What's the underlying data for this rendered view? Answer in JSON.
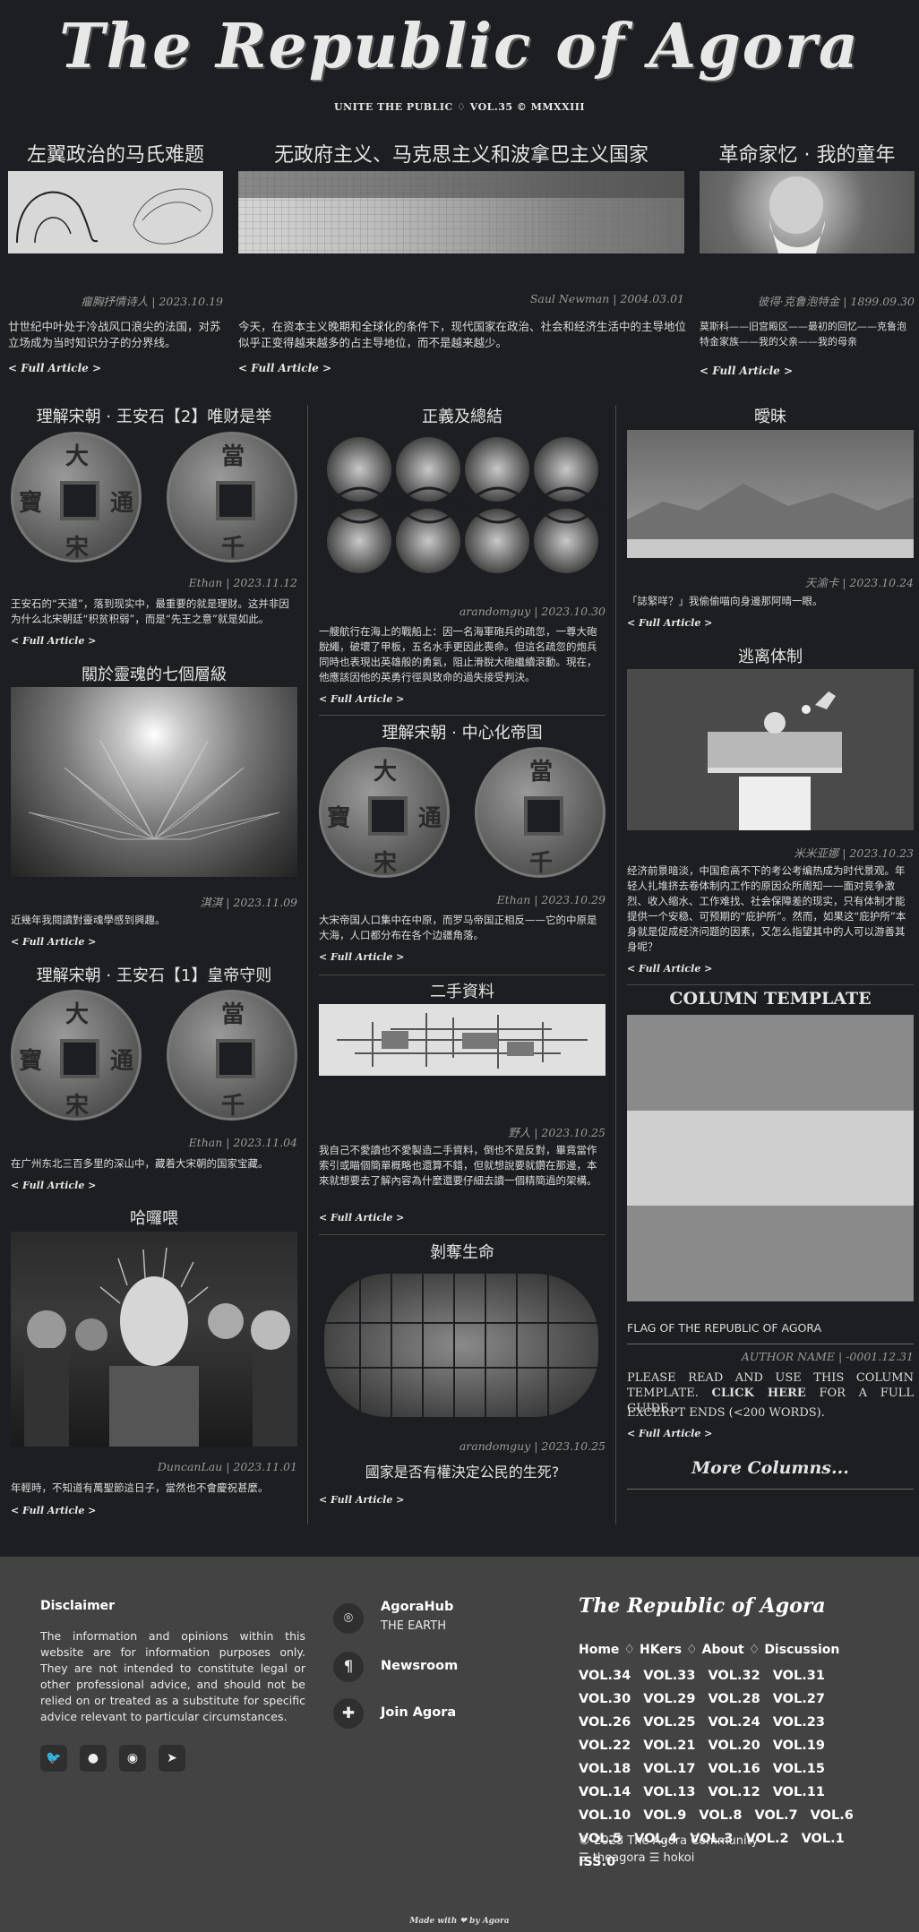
{
  "masthead": {
    "title": "The Republic of Agora",
    "tagline": "UNITE THE PUBLIC ♢ VOL.35 © MMXXIII"
  },
  "top_articles": [
    {
      "title": "左翼政治的马氏难题",
      "meta": "瘤胸抒情诗人 | 2023.10.19",
      "excerpt": "廿世纪中叶处于冷战风口浪尖的法国，对苏立场成为当时知识分子的分界线。",
      "more": "< Full Article >"
    },
    {
      "title": "无政府主义、马克思主义和波拿巴主义国家",
      "meta": "Saul Newman | 2004.03.01",
      "excerpt": "今天，在资本主义晚期和全球化的条件下，现代国家在政治、社会和经济生活中的主导地位似乎正变得越来越多的占主导地位，而不是越来越少。",
      "more": "< Full Article >"
    },
    {
      "title": "革命家忆 · 我的童年",
      "meta": "彼得·克鲁泡特金 | 1899.09.30",
      "excerpt": "莫斯科——旧宫殿区——最初的回忆——克鲁泡特金家族——我的父亲——我的母亲",
      "more": "< Full Article >"
    }
  ],
  "col1": [
    {
      "title": "理解宋朝 · 王安石【2】唯财是举",
      "meta": "Ethan | 2023.11.12",
      "excerpt": "王安石的“天道”，落到现实中，最重要的就是理财。这并非因为什么北宋朝廷“积贫积弱”，而是“先王之意”就是如此。",
      "more": "< Full Article >"
    },
    {
      "title": "關於靈魂的七個層級",
      "meta": "淇淇 | 2023.11.09",
      "excerpt": "近幾年我閱讀對靈魂學感到興趣。",
      "more": "< Full Article >"
    },
    {
      "title": "理解宋朝 · 王安石【1】皇帝守则",
      "meta": "Ethan | 2023.11.04",
      "excerpt": "在广州东北三百多里的深山中，藏着大宋朝的国家宝藏。",
      "more": "< Full Article >"
    },
    {
      "title": "哈囉喂",
      "meta": "DuncanLau | 2023.11.01",
      "excerpt": "年輕時，不知道有萬聖節這日子，當然也不會慶祝甚麼。",
      "more": "< Full Article >"
    }
  ],
  "col2": [
    {
      "title": "正義及總結",
      "meta": "arandomguy | 2023.10.30",
      "excerpt": "一艘航行在海上的戰船上：因一名海軍砲兵的疏忽，一尊大砲脫繩，破壞了甲板，五名水手更因此喪命。但這名疏忽的炮兵同時也表現出英雄般的勇氣，阻止滑脫大砲繼續滾動。現在，他應該因他的英勇行徑與致命的過失接受判決。",
      "more": "< Full Article >"
    },
    {
      "title": "理解宋朝 · 中心化帝国",
      "meta": "Ethan | 2023.10.29",
      "excerpt": "大宋帝国人口集中在中原，而罗马帝国正相反——它的中原是大海，人口都分布在各个边疆角落。",
      "more": "< Full Article >"
    },
    {
      "title": "二手資料",
      "meta": "野人 | 2023.10.25",
      "excerpt": "我自己不愛讀也不愛製造二手資料，倒也不是反對，畢竟當作索引或瞄個簡單概略也還算不錯，但就想說要就鑽在那邊，本來就想要去了解內容為什麼還要仔細去讀一個精簡過的架構。",
      "more": "< Full Article >"
    },
    {
      "title": "剝奪生命",
      "meta": "arandomguy | 2023.10.25",
      "subtitle": "國家是否有權決定公民的生死?",
      "more": "< Full Article >"
    }
  ],
  "col3": [
    {
      "title": "曖昧",
      "meta": "天渝卡 | 2023.10.24",
      "excerpt": "「誌緊咩？」我偷偷喵向身邊那阿晴一眼。",
      "more": "< Full Article >"
    },
    {
      "title": "逃离体制",
      "meta": "米米亚娜 | 2023.10.23",
      "excerpt": "经济前景暗淡，中国愈高不下的考公考编热成为时代景观。年轻人扎堆挤去卷体制内工作的原因众所周知——面对竞争激烈、收入缩水、工作难找、社会保障差的现实，只有体制才能提供一个安稳、可预期的“庇护所”。然而，如果这“庇护所”本身就是促成经济问题的因素，又怎么指望其中的人可以游善其身呢？",
      "more": "< Full Article >"
    },
    {
      "title": "COLUMN TEMPLATE",
      "caption": "FLAG OF THE REPUBLIC OF AGORA",
      "meta": "AUTHOR NAME | -0001.12.31",
      "excerpt_a": "PLEASE READ AND USE THIS COLUMN TEMPLATE.",
      "excerpt_link": "CLICK HERE",
      "excerpt_b": "FOR A FULL GUIDE.",
      "excerpt2": "EXCERPT ENDS (<200 WORDS).",
      "more": "< Full Article >"
    },
    {
      "title": "More Columns..."
    }
  ],
  "footer": {
    "disclaimer_title": "Disclaimer",
    "disclaimer": "The information and opinions within this website are for information purposes only. They are not intended to constitute legal or other professional advice, and should not be relied on or treated as a substitute for specific advice relevant to particular circumstances.",
    "social_icons": [
      "twitter-icon",
      "github-icon",
      "reddit-icon",
      "telegram-icon"
    ],
    "links": [
      {
        "label": "AgoraHub",
        "sub": "THE EARTH",
        "icon": "location-pin-icon"
      },
      {
        "label": "Newsroom",
        "icon": "pilcrow-icon"
      },
      {
        "label": "Join Agora",
        "icon": "puzzle-icon"
      }
    ],
    "logo": "The Republic of Agora",
    "nav": [
      "Home",
      "HKers",
      "About",
      "Discussion"
    ],
    "nav_sep": "♢",
    "volumes": [
      "VOL.34",
      "VOL.33",
      "VOL.32",
      "VOL.31",
      "VOL.30",
      "VOL.29",
      "VOL.28",
      "VOL.27",
      "VOL.26",
      "VOL.25",
      "VOL.24",
      "VOL.23",
      "VOL.22",
      "VOL.21",
      "VOL.20",
      "VOL.19",
      "VOL.18",
      "VOL.17",
      "VOL.16",
      "VOL.15",
      "VOL.14",
      "VOL.13",
      "VOL.12",
      "VOL.11",
      "VOL.10",
      "VOL.9",
      "VOL.8",
      "VOL.7",
      "VOL.6",
      "VOL.5",
      "VOL.4",
      "VOL.3",
      "VOL.2",
      "VOL.1",
      "ISS.0"
    ],
    "copyright": "© 2023 The Agora Community",
    "handles": "☰ theagora ☰ hokoi",
    "made_with": "Made with ❤ by Agora"
  }
}
